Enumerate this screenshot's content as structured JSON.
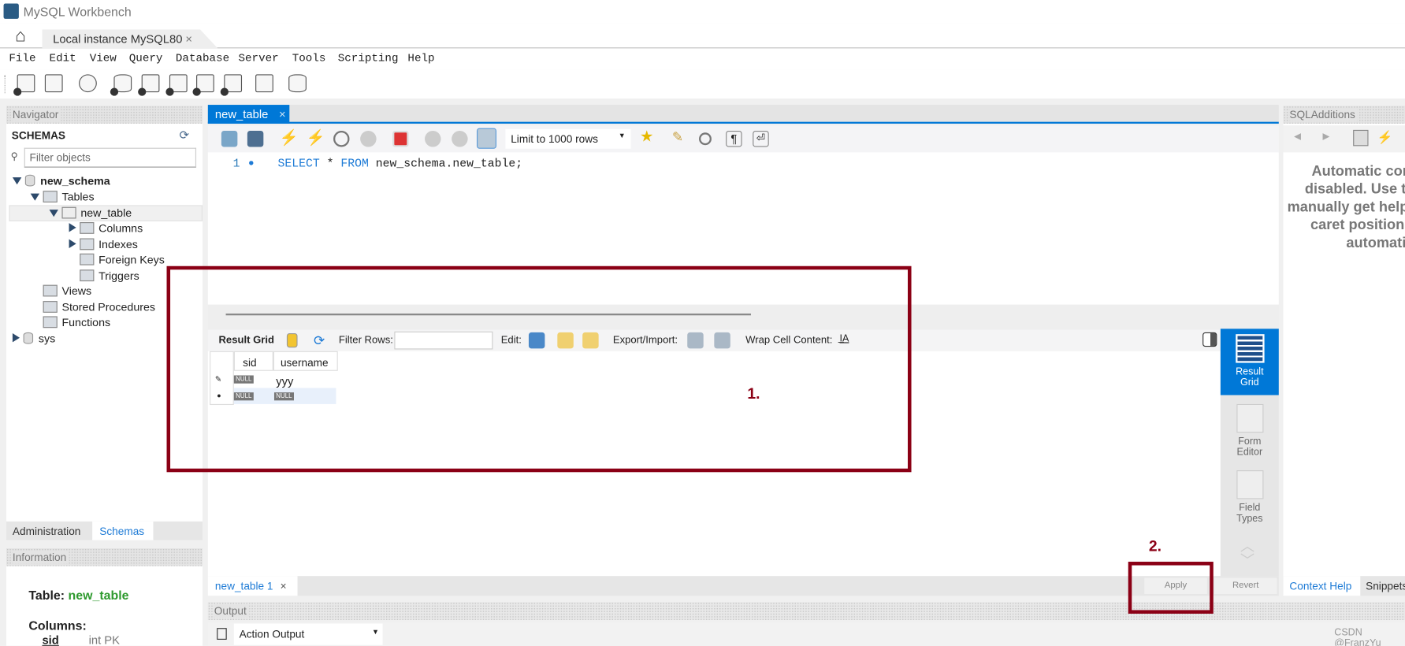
{
  "window": {
    "title": "MySQL Workbench"
  },
  "connection_tab": {
    "label": "Local instance MySQL80",
    "close": "×"
  },
  "menu": [
    "File",
    "Edit",
    "View",
    "Query",
    "Database",
    "Server",
    "Tools",
    "Scripting",
    "Help"
  ],
  "navigator": {
    "header": "Navigator",
    "schemas_title": "SCHEMAS",
    "filter_placeholder": "Filter objects",
    "tree": {
      "schema": "new_schema",
      "tables": "Tables",
      "table": "new_table",
      "columns": "Columns",
      "indexes": "Indexes",
      "foreign_keys": "Foreign Keys",
      "triggers": "Triggers",
      "views": "Views",
      "procedures": "Stored Procedures",
      "functions": "Functions",
      "sys": "sys"
    },
    "tabs": [
      "Administration",
      "Schemas"
    ],
    "active_tab": "Schemas"
  },
  "information": {
    "header": "Information",
    "table_label": "Table:",
    "table_name": "new_table",
    "columns_label": "Columns:",
    "column_name": "sid",
    "column_type": "int PK"
  },
  "editor": {
    "tab": "new_table",
    "close": "×",
    "limit": "Limit to 1000 rows",
    "line_number": "1",
    "sql_keyword1": "SELECT",
    "sql_star": " * ",
    "sql_keyword2": "FROM",
    "sql_rest": " new_schema.new_table;"
  },
  "result": {
    "toolbar": {
      "result_grid": "Result Grid",
      "filter_rows": "Filter Rows:",
      "edit": "Edit:",
      "export_import": "Export/Import:",
      "wrap": "Wrap Cell Content:"
    },
    "columns": [
      "sid",
      "username"
    ],
    "rows": [
      {
        "marker": "✎",
        "sid": "NULL",
        "username": "yyy"
      },
      {
        "marker": "●",
        "sid": "NULL",
        "username": "NULL"
      }
    ],
    "side": [
      {
        "label": "Result Grid",
        "active": true
      },
      {
        "label": "Form Editor",
        "active": false
      },
      {
        "label": "Field Types",
        "active": false
      }
    ],
    "bottom_tab": "new_table 1",
    "apply": "Apply",
    "revert": "Revert"
  },
  "sql_additions": {
    "header": "SQLAdditions",
    "message": "Automatic context help is disabled. Use the toolbar to manually get help for the current caret position or to toggle automatic help.",
    "tabs": [
      "Context Help",
      "Snippets"
    ]
  },
  "output": {
    "header": "Output",
    "selector": "Action Output"
  },
  "annotations": {
    "label1": "1.",
    "label2": "2.",
    "color": "#8b0015"
  },
  "watermark": "CSDN @FranzYu_",
  "colors": {
    "accent": "#0078d7",
    "keyword": "#1e7bd6",
    "table_name": "#2e9a2e"
  }
}
